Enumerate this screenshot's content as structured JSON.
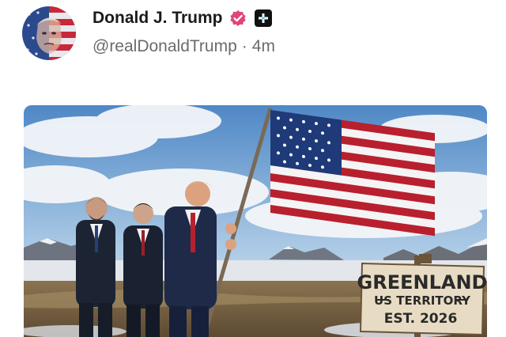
{
  "post": {
    "author": {
      "display_name": "Donald J. Trump",
      "handle": "@realDonaldTrump",
      "separator": "·",
      "time_ago": "4m",
      "verified_icon": "verified-badge-icon",
      "verified_color": "#e0457b",
      "plus_icon": "plus-square-icon"
    },
    "image": {
      "sign_line1": "GREENLAND",
      "sign_line2": "US TERRITORY",
      "sign_line3": "EST. 2026"
    }
  }
}
